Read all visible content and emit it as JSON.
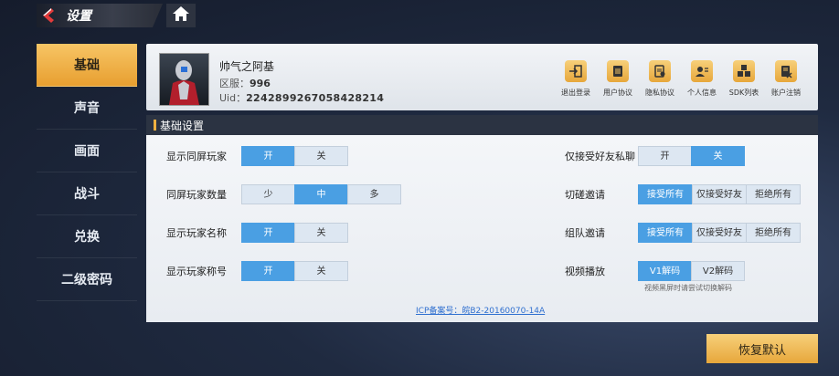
{
  "header": {
    "title": "设置"
  },
  "sidebar": {
    "items": [
      {
        "label": "基础"
      },
      {
        "label": "声音"
      },
      {
        "label": "画面"
      },
      {
        "label": "战斗"
      },
      {
        "label": "兑换"
      },
      {
        "label": "二级密码"
      }
    ],
    "active_index": 0
  },
  "profile": {
    "name": "帅气之阿基",
    "server_label": "区服：",
    "server_value": "996",
    "uid_label": "Uid：",
    "uid_value": "2242899267058428214",
    "actions": [
      {
        "label": "退出登录",
        "icon": "logout-icon"
      },
      {
        "label": "用户协议",
        "icon": "document-icon"
      },
      {
        "label": "隐私协议",
        "icon": "privacy-doc-icon"
      },
      {
        "label": "个人信息",
        "icon": "person-card-icon"
      },
      {
        "label": "SDK列表",
        "icon": "cubes-icon"
      },
      {
        "label": "账户注销",
        "icon": "delete-doc-icon"
      }
    ]
  },
  "section": {
    "title": "基础设置"
  },
  "settings": {
    "show_same_screen": {
      "label": "显示同屏玩家",
      "options": [
        "开",
        "关"
      ],
      "selected": "开"
    },
    "same_screen_count": {
      "label": "同屏玩家数量",
      "options": [
        "少",
        "中",
        "多"
      ],
      "selected": "中"
    },
    "show_player_name": {
      "label": "显示玩家名称",
      "options": [
        "开",
        "关"
      ],
      "selected": "开"
    },
    "show_player_title": {
      "label": "显示玩家称号",
      "options": [
        "开",
        "关"
      ],
      "selected": "开"
    },
    "friends_only_chat": {
      "label": "仅接受好友私聊",
      "options": [
        "开",
        "关"
      ],
      "selected": "关"
    },
    "spar_invite": {
      "label": "切磋邀请",
      "options": [
        "接受所有",
        "仅接受好友",
        "拒绝所有"
      ],
      "selected": "接受所有"
    },
    "team_invite": {
      "label": "组队邀请",
      "options": [
        "接受所有",
        "仅接受好友",
        "拒绝所有"
      ],
      "selected": "接受所有"
    },
    "video_play": {
      "label": "视频播放",
      "options": [
        "V1解码",
        "V2解码"
      ],
      "selected": "V1解码",
      "hint": "视频黑屏时请尝试切换解码"
    }
  },
  "icp": "ICP备案号：皖B2-20160070-14A",
  "reset_button": "恢复默认",
  "colors": {
    "accent": "#e89f30",
    "selected": "#4a9fe3"
  }
}
